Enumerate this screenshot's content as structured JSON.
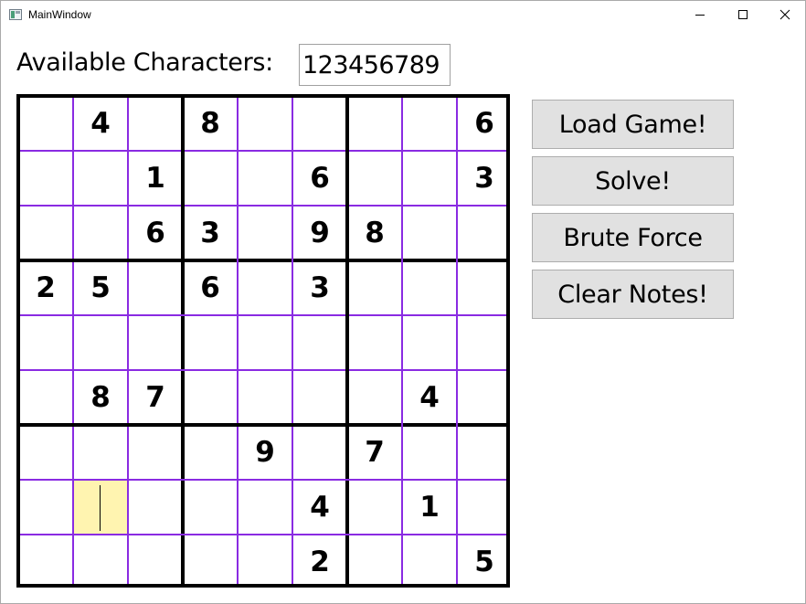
{
  "window": {
    "title": "MainWindow",
    "controls": {
      "minimize": "minimize",
      "maximize": "maximize",
      "close": "×"
    }
  },
  "chars": {
    "label": "Available Characters:",
    "value": "123456789"
  },
  "board": {
    "rows": [
      [
        "",
        "4",
        "",
        "8",
        "",
        "",
        "",
        "",
        "6"
      ],
      [
        "",
        "",
        "1",
        "",
        "",
        "6",
        "",
        "",
        "3"
      ],
      [
        "",
        "",
        "6",
        "3",
        "",
        "9",
        "8",
        "",
        ""
      ],
      [
        "2",
        "5",
        "",
        "6",
        "",
        "3",
        "",
        "",
        ""
      ],
      [
        "",
        "",
        "",
        "",
        "",
        "",
        "",
        "",
        ""
      ],
      [
        "",
        "8",
        "7",
        "",
        "",
        "",
        "",
        "4",
        ""
      ],
      [
        "",
        "",
        "",
        "",
        "9",
        "",
        "7",
        "",
        ""
      ],
      [
        "",
        "",
        "",
        "",
        "",
        "4",
        "",
        "1",
        ""
      ],
      [
        "",
        "",
        "",
        "",
        "",
        "2",
        "",
        "",
        "5"
      ]
    ],
    "selected": {
      "row": 7,
      "col": 1
    },
    "colors": {
      "cell_line": "#8a2be2",
      "box_line": "#000000",
      "selected_bg": "#fff4b0"
    }
  },
  "buttons": {
    "load": "Load Game!",
    "solve": "Solve!",
    "brute": "Brute Force",
    "clear": "Clear Notes!"
  }
}
